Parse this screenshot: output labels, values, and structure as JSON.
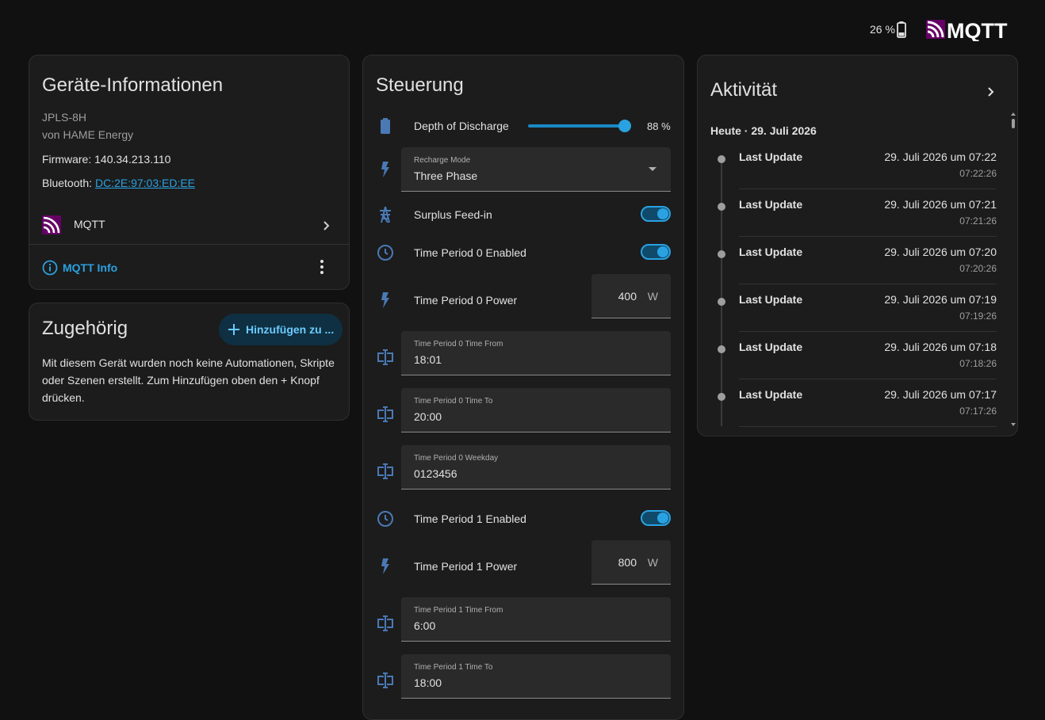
{
  "header": {
    "battery": "26 %",
    "brand": "MQTT",
    "brand_color": "#7b1fa2"
  },
  "device_info": {
    "title": "Geräte-Informationen",
    "model": "JPLS-8H",
    "manufacturer": "von HAME Energy",
    "firmware_label": "Firmware:",
    "firmware_value": "140.34.213.110",
    "bluetooth_label": "Bluetooth:",
    "bluetooth_value": "DC:2E:97:03:ED:EE",
    "integration_label": "MQTT",
    "info_button": "MQTT Info"
  },
  "related": {
    "title": "Zugehörig",
    "add_button": "Hinzufügen zu ...",
    "text": "Mit diesem Gerät wurden noch keine Automationen, Skripte oder Szenen erstellt. Zum Hinzufügen oben den + Knopf drücken."
  },
  "control": {
    "title": "Steuerung",
    "dod_label": "Depth of Discharge",
    "dod_value": "88 %",
    "dod_level": 0.88,
    "recharge_label": "Recharge Mode",
    "recharge_value": "Three Phase",
    "surplus_label": "Surplus Feed-in",
    "tp0_enabled_label": "Time Period 0 Enabled",
    "tp0_power_label": "Time Period 0 Power",
    "tp0_power_value": "400",
    "unit_w": "W",
    "tp0_from_label": "Time Period 0 Time From",
    "tp0_from_value": "18:01",
    "tp0_to_label": "Time Period 0 Time To",
    "tp0_to_value": "20:00",
    "tp0_weekday_label": "Time Period 0 Weekday",
    "tp0_weekday_value": "0123456",
    "tp1_enabled_label": "Time Period 1 Enabled",
    "tp1_power_label": "Time Period 1 Power",
    "tp1_power_value": "800",
    "tp1_from_label": "Time Period 1 Time From",
    "tp1_from_value": "6:00",
    "tp1_to_label": "Time Period 1 Time To",
    "tp1_to_value": "18:00"
  },
  "activity": {
    "title": "Aktivität",
    "day": "Heute · 29. Juli 2026",
    "items": [
      {
        "name": "Last Update",
        "date": "29. Juli 2026 um 07:22",
        "time": "07:22:26"
      },
      {
        "name": "Last Update",
        "date": "29. Juli 2026 um 07:21",
        "time": "07:21:26"
      },
      {
        "name": "Last Update",
        "date": "29. Juli 2026 um 07:20",
        "time": "07:20:26"
      },
      {
        "name": "Last Update",
        "date": "29. Juli 2026 um 07:19",
        "time": "07:19:26"
      },
      {
        "name": "Last Update",
        "date": "29. Juli 2026 um 07:18",
        "time": "07:18:26"
      },
      {
        "name": "Last Update",
        "date": "29. Juli 2026 um 07:17",
        "time": "07:17:26"
      }
    ]
  },
  "colors": {
    "accent": "#2aa1e0",
    "icon": "#4a79b5"
  }
}
